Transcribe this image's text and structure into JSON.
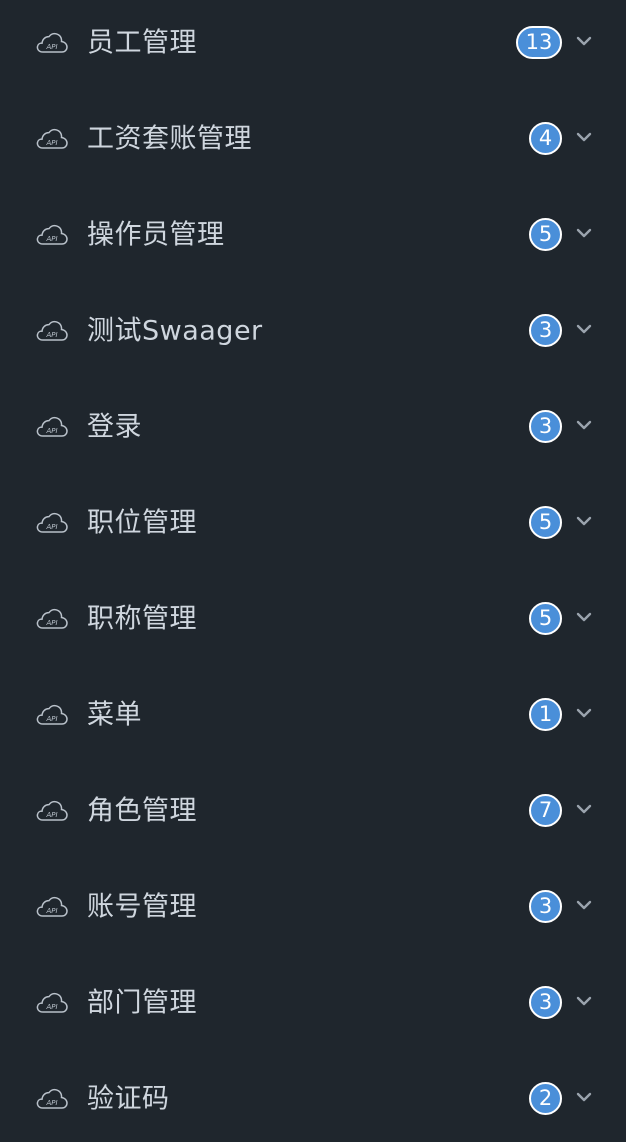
{
  "menu": {
    "items": [
      {
        "label": "员工管理",
        "count": "13"
      },
      {
        "label": "工资套账管理",
        "count": "4"
      },
      {
        "label": "操作员管理",
        "count": "5"
      },
      {
        "label": "测试Swaager",
        "count": "3"
      },
      {
        "label": "登录",
        "count": "3"
      },
      {
        "label": "职位管理",
        "count": "5"
      },
      {
        "label": "职称管理",
        "count": "5"
      },
      {
        "label": "菜单",
        "count": "1"
      },
      {
        "label": "角色管理",
        "count": "7"
      },
      {
        "label": "账号管理",
        "count": "3"
      },
      {
        "label": "部门管理",
        "count": "3"
      },
      {
        "label": "验证码",
        "count": "2"
      }
    ],
    "icon": "api-cloud-icon",
    "expand_icon": "chevron-down-icon",
    "colors": {
      "background": "#1f262d",
      "text": "#cfd6de",
      "badge": "#4a8fd9",
      "badge_border": "#ffffff"
    }
  }
}
